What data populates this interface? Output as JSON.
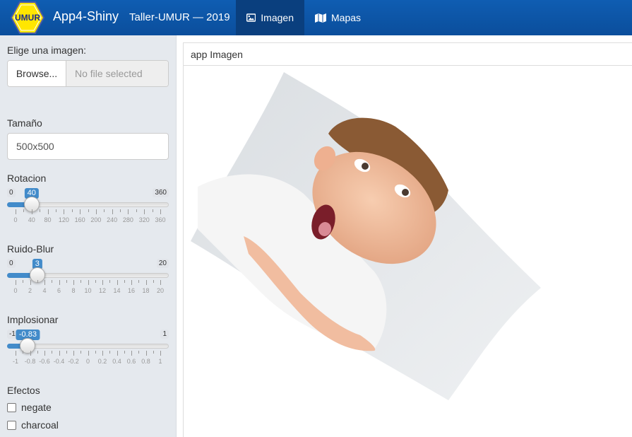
{
  "navbar": {
    "logo_text": "UMUR",
    "brand": "App4-Shiny",
    "subtitle": "Taller-UMUR — 2019",
    "tabs": [
      {
        "label": "Imagen",
        "icon": "image-icon",
        "active": true
      },
      {
        "label": "Mapas",
        "icon": "map-icon",
        "active": false
      }
    ],
    "color": "#0f5db2",
    "active_tab_color": "#0a3f7e"
  },
  "sidebar": {
    "file_label": "Elige una imagen:",
    "browse_label": "Browse...",
    "file_placeholder": "No file selected",
    "size_label": "Tamaño",
    "size_value": "500x500",
    "sliders": [
      {
        "label": "Rotacion",
        "min": "0",
        "max": "360",
        "value": "40",
        "grid": [
          "0",
          "40",
          "80",
          "120",
          "160",
          "200",
          "240",
          "280",
          "320",
          "360"
        ]
      },
      {
        "label": "Ruido-Blur",
        "min": "0",
        "max": "20",
        "value": "3",
        "grid": [
          "0",
          "2",
          "4",
          "6",
          "8",
          "10",
          "12",
          "14",
          "16",
          "18",
          "20"
        ]
      },
      {
        "label": "Implosionar",
        "min": "-1",
        "max": "1",
        "value": "-0.83",
        "grid": [
          "-1",
          "-0.8",
          "-0.6",
          "-0.4",
          "-0.2",
          "0",
          "0.2",
          "0.4",
          "0.6",
          "0.8",
          "1"
        ]
      }
    ],
    "effects_label": "Efectos",
    "effects": [
      {
        "label": "negate",
        "checked": false
      },
      {
        "label": "charcoal",
        "checked": false
      }
    ],
    "accent": "#428bca"
  },
  "main": {
    "panel_title": "app Imagen"
  }
}
